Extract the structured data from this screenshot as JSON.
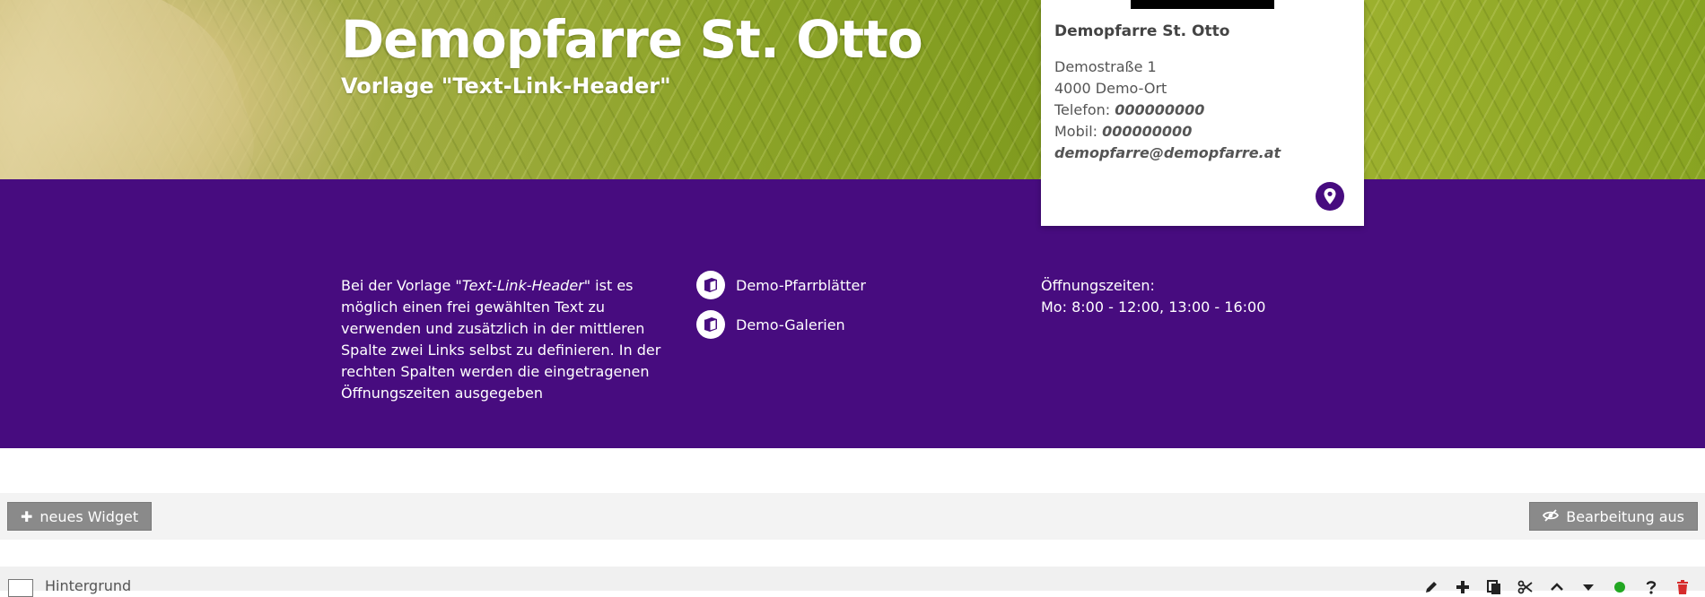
{
  "hero": {
    "title": "Demopfarre St. Otto",
    "subtitle": "Vorlage \"Text-Link-Header\""
  },
  "contact": {
    "name": "Demopfarre St. Otto",
    "street": "Demostraße 1",
    "city": "4000 Demo-Ort",
    "phone_label": "Telefon:",
    "phone": "000000000",
    "mobile_label": "Mobil:",
    "mobile": "000000000",
    "email": "demopfarre@demopfarre.at"
  },
  "intro": {
    "before": "Bei der Vorlage \"",
    "emphasis": "Text-Link-Header",
    "after": "\" ist es möglich einen frei gewählten Text zu verwenden und zusätzlich in der mittleren Spalte zwei Links selbst zu definieren. In der rechten Spalten werden die eingetragenen Öffnungszeiten ausgegeben"
  },
  "links": [
    {
      "label": "Demo-Pfarrblätter"
    },
    {
      "label": "Demo-Galerien"
    }
  ],
  "hours": {
    "title": "Öffnungszeiten:",
    "text": "Mo: 8:00 - 12:00, 13:00 - 16:00"
  },
  "toolbar": {
    "new_widget": "neues Widget",
    "edit_off": "Bearbeitung aus"
  },
  "widget": {
    "label": "Hintergrund"
  },
  "colors": {
    "purple": "#470c7f",
    "button_grey": "#8a8a8a",
    "status_green": "#22a722",
    "delete_red": "#d62b2b"
  },
  "icons": {
    "link": "box-icon",
    "map": "map-pin-icon",
    "new_widget": "plus-icon",
    "edit_off": "eye-slash-icon",
    "tools": [
      "pencil-icon",
      "plus-icon",
      "copy-icon",
      "scissors-icon",
      "chevron-up-icon",
      "caret-down-icon",
      "status-dot-icon",
      "help-icon",
      "trash-icon"
    ]
  }
}
